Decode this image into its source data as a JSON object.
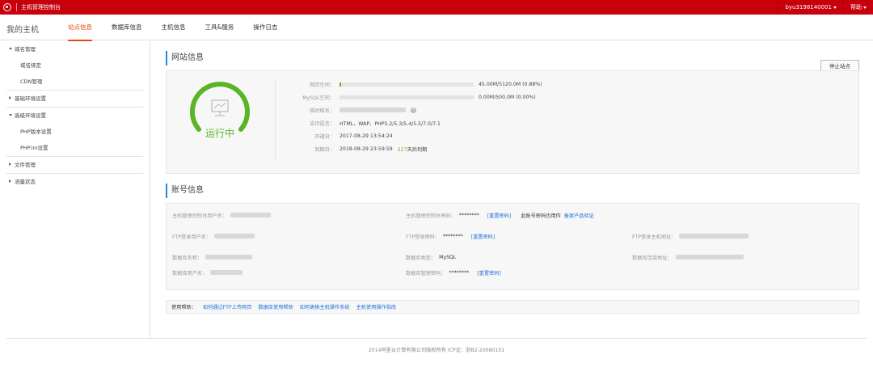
{
  "topbar": {
    "app_title": "主机管理控制台",
    "username": "byu3198140001",
    "help": "帮助"
  },
  "header": {
    "my_host": "我的主机",
    "tabs": [
      {
        "label": "站点信息",
        "active": true
      },
      {
        "label": "数据库信息",
        "active": false
      },
      {
        "label": "主机信息",
        "active": false
      },
      {
        "label": "工具&服务",
        "active": false
      },
      {
        "label": "操作日志",
        "active": false
      }
    ]
  },
  "sidebar": {
    "groups": [
      {
        "label": "域名管理",
        "expanded": true,
        "items": [
          "域名绑定",
          "CDN管理"
        ]
      },
      {
        "label": "基础环境设置",
        "expanded": false,
        "items": []
      },
      {
        "label": "高级环境设置",
        "expanded": true,
        "items": [
          "PHP版本设置",
          "PHP.ini设置"
        ]
      },
      {
        "label": "文件管理",
        "expanded": false,
        "items": []
      },
      {
        "label": "流量状态",
        "expanded": false,
        "items": []
      }
    ]
  },
  "site_info": {
    "title": "网站信息",
    "stop_button": "停止站点",
    "status": "运行中",
    "status_color": "#5ab526",
    "web_space_label": "网页空间：",
    "web_space_value": "45.00M/5120.0M (0.88%)",
    "web_space_fraction": 0.0088,
    "mysql_space_label": "MySQL空间：",
    "mysql_space_value": "0.00M/500.0M (0.00%)",
    "mysql_space_fraction": 0.0,
    "temp_domain_label": "临时域名：",
    "languages_label": "支持语言：",
    "languages_value": "HTML、WAP、PHP5.2/5.3/5.4/5.5/7.0/7.1",
    "open_date_label": "开通日：",
    "open_date_value": "2017-08-29 13:54:24",
    "expire_date_label": "到期日：",
    "expire_date_value": "2018-08-29 23:59:59",
    "days_left": "227",
    "days_left_suffix": "天后到期"
  },
  "account_info": {
    "title": "账号信息",
    "console_user_label": "主机管理控制台用户名：",
    "console_pwd_label": "主机管理控制台密码：",
    "console_pwd_value": "********",
    "reset_pwd": "[重置密码]",
    "console_pwd_note": "此账号密码也用作",
    "console_pwd_link": "备案产品验证",
    "ftp_user_label": "FTP登录用户名：",
    "ftp_pwd_label": "FTP登录密码：",
    "ftp_pwd_value": "********",
    "ftp_host_label": "FTP登录主机地址：",
    "db_name_label": "数据库名称：",
    "db_type_label": "数据库类型：",
    "db_type_value": "MySQL",
    "db_host_label": "数据库连接地址：",
    "db_user_label": "数据库用户名：",
    "db_pwd_label": "数据库管理密码：",
    "db_pwd_value": "********"
  },
  "help_bar": {
    "label": "使用帮助：",
    "links": [
      "如何通过FTP上传网页",
      "数据库使用帮助",
      "如何更换主机操作系统",
      "主机使用操作指南"
    ]
  },
  "footer": {
    "text": "2014阿里云计算有限公司版权所有 ICP证：浙B2-20080101"
  },
  "colors": {
    "brand_red": "#c7000b",
    "active_tab": "#e8470c",
    "link_blue": "#1e6fd9",
    "status_green": "#5ab526"
  }
}
